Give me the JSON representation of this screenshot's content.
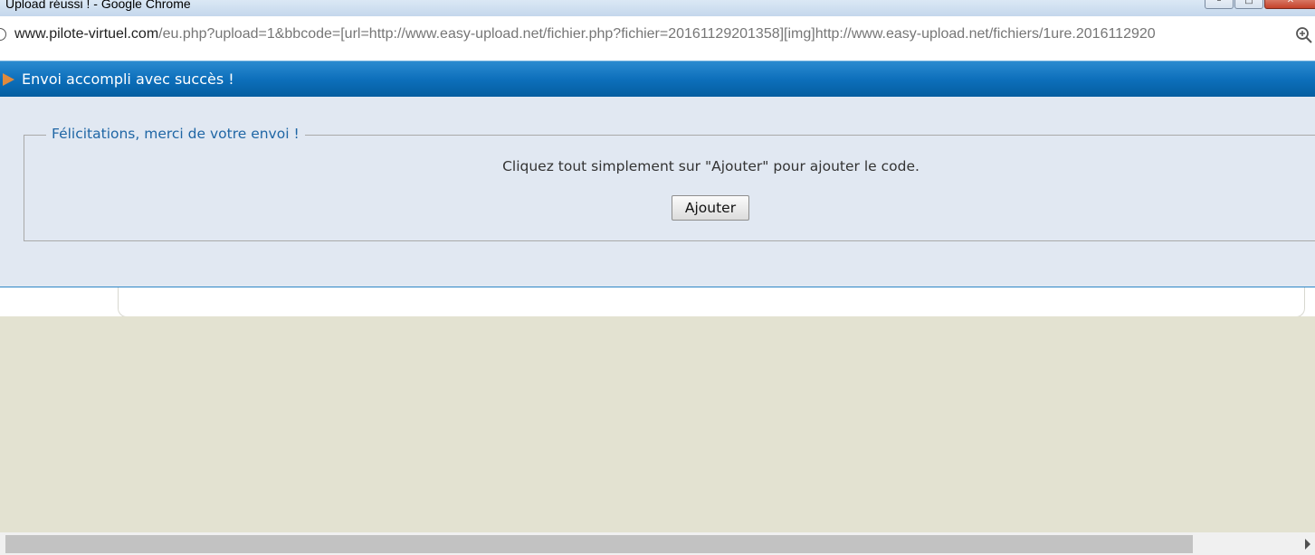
{
  "window": {
    "title": "Upload réussi ! - Google Chrome",
    "controls": {
      "minimize": "–",
      "maximize": "□",
      "close": "✕"
    }
  },
  "browser": {
    "url_host": "www.pilote-virtuel.com",
    "url_rest": "/eu.php?upload=1&bbcode=[url=http://www.easy-upload.net/fichier.php?fichier=20161129201358][img]http://www.easy-upload.net/fichiers/1ure.2016112920",
    "icons": {
      "info": "info-icon",
      "zoom": "zoom-icon"
    }
  },
  "header": {
    "title": "Envoi accompli avec succès !",
    "icon": "arrow-icon"
  },
  "panel": {
    "legend": "Félicitations, merci de votre envoi !",
    "instruction": "Cliquez tout simplement sur \"Ajouter\" pour ajouter le code.",
    "button_label": "Ajouter"
  },
  "colors": {
    "header_blue": "#0d6fbb",
    "panel_bg": "#e1e8f2",
    "legend_text": "#1f66a5",
    "page_bg": "#e3e2d1"
  }
}
